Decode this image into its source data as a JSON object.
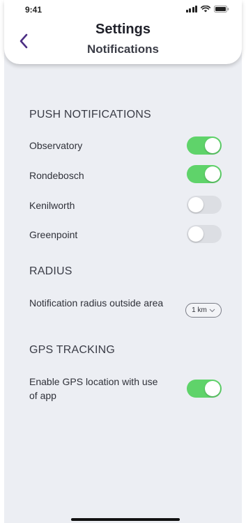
{
  "status_bar": {
    "time": "9:41"
  },
  "header": {
    "title": "Settings",
    "subtitle": "Notifications"
  },
  "push_notifications": {
    "heading": "PUSH NOTIFICATIONS",
    "items": [
      {
        "label": "Observatory",
        "enabled": true
      },
      {
        "label": "Rondebosch",
        "enabled": true
      },
      {
        "label": "Kenilworth",
        "enabled": false
      },
      {
        "label": "Greenpoint",
        "enabled": false
      }
    ]
  },
  "radius": {
    "heading": "RADIUS",
    "label": "Notification radius outside area",
    "selected": "1 km"
  },
  "gps_tracking": {
    "heading": "GPS TRACKING",
    "label": "Enable GPS location with use of app",
    "enabled": true
  },
  "colors": {
    "toggle_on": "#5fd36a",
    "toggle_off": "#dcdee3",
    "accent": "#4b2e83"
  }
}
